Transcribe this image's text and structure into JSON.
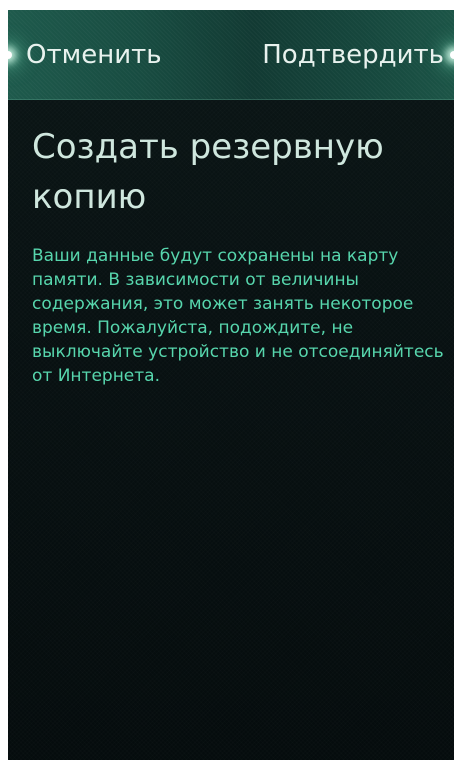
{
  "header": {
    "cancel_label": "Отменить",
    "confirm_label": "Подтвердить"
  },
  "main": {
    "title": "Создать резервную копию",
    "description": "Ваши данные будут сохранены на карту памяти. В зависимости от величины содержания, это может занять некоторое время. Пожалуйста, подождите, не выключайте устройство и не отсоединяйтесь от Интернета."
  },
  "colors": {
    "header_background": "#184c41",
    "accent_text": "#57d6ad",
    "title_text": "#cfe7de",
    "screen_background": "#081112"
  }
}
